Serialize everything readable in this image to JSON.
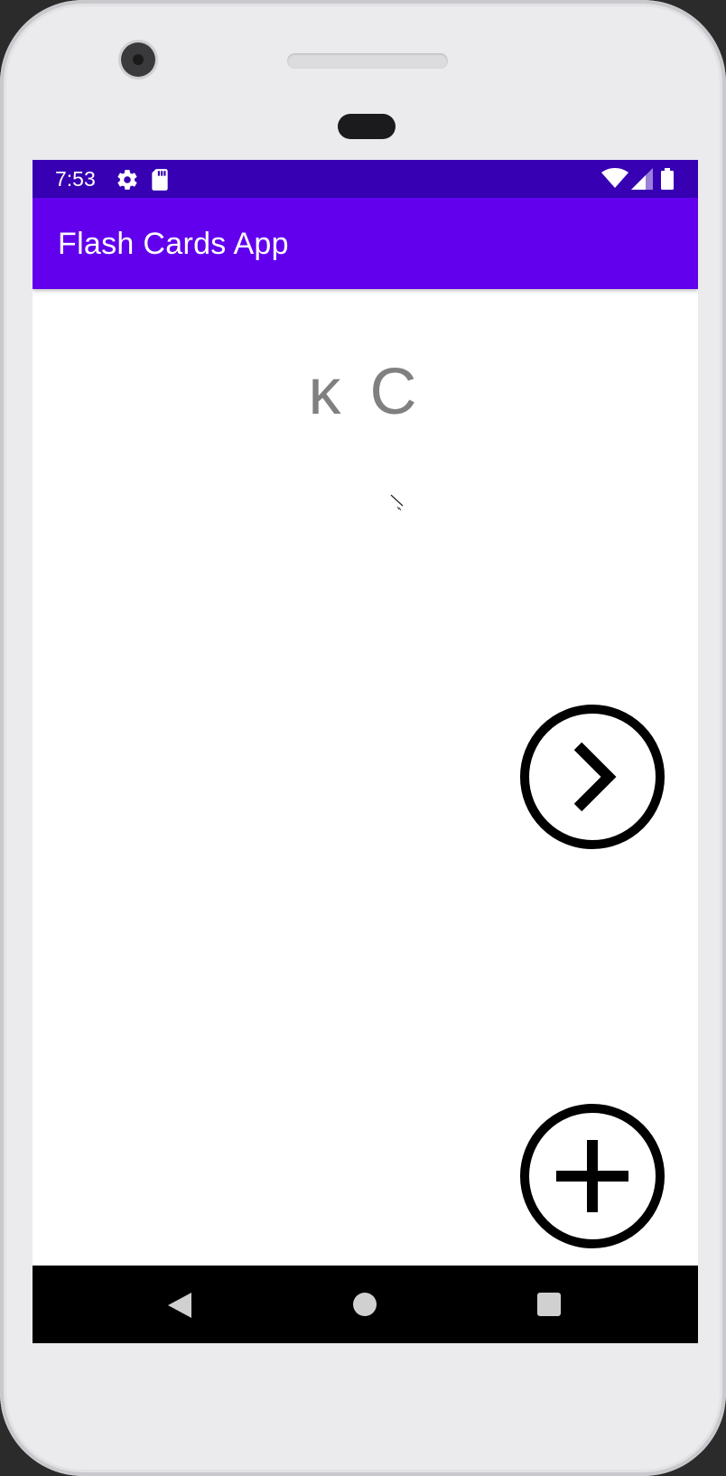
{
  "status_bar": {
    "time": "7:53",
    "icons": [
      "settings-icon",
      "sd-card-icon",
      "wifi-icon",
      "cell-signal-icon",
      "battery-icon"
    ]
  },
  "app_bar": {
    "title": "Flash Cards App"
  },
  "card": {
    "text": "ĸ C"
  },
  "buttons": {
    "next_icon": "chevron-right-circle-icon",
    "add_icon": "plus-circle-icon"
  },
  "nav_bar": {
    "icons": [
      "back-icon",
      "home-icon",
      "recents-icon"
    ]
  },
  "colors": {
    "status_bar": "#3700b3",
    "app_bar": "#6200ee",
    "card_text": "#808080",
    "nav_bar": "#000000"
  }
}
